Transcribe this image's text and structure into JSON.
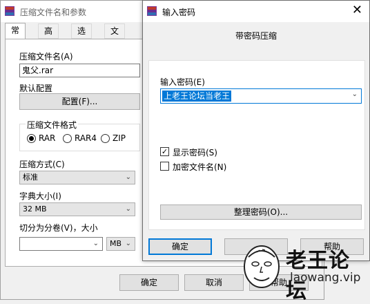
{
  "main_window": {
    "title": "压缩文件名和参数",
    "tabs": [
      "常规",
      "高级",
      "选项",
      "文件"
    ],
    "archive_name_label": "压缩文件名(A)",
    "archive_name_value": "鬼父.rar",
    "default_profile_label": "默认配置",
    "profiles_button": "配置(F)...",
    "format_group_label": "压缩文件格式",
    "formats": [
      "RAR",
      "RAR4",
      "ZIP"
    ],
    "selected_format": "RAR",
    "method_label": "压缩方式(C)",
    "method_value": "标准",
    "dict_label": "字典大小(I)",
    "dict_value": "32 MB",
    "split_label": "切分为分卷(V)，大小",
    "split_value": "",
    "split_unit": "MB",
    "buttons": {
      "ok": "确定",
      "cancel": "取消",
      "help": "帮助"
    }
  },
  "password_dialog": {
    "title": "输入密码",
    "subtitle": "带密码压缩",
    "password_label": "输入密码(E)",
    "password_value": "上老王论坛当老王",
    "show_password": "显示密码(S)",
    "show_password_checked": true,
    "encrypt_names": "加密文件名(N)",
    "encrypt_names_checked": false,
    "organize_button": "整理密码(O)...",
    "buttons": {
      "ok": "确定",
      "help": "帮助"
    }
  },
  "watermark": {
    "title": "老王论坛",
    "url": "laowang.vip"
  }
}
